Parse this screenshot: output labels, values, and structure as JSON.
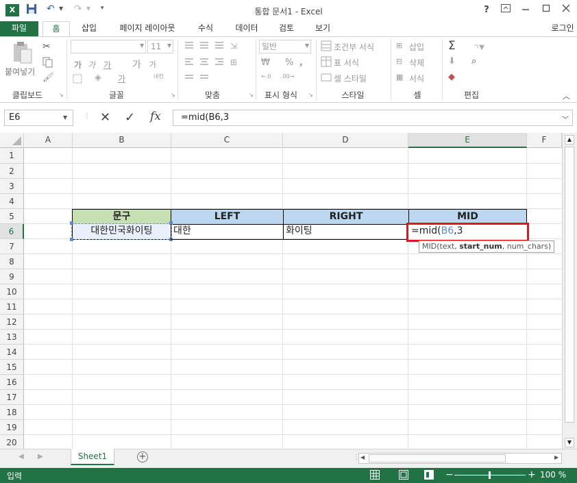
{
  "window": {
    "title": "통합 문서1 - Excel",
    "logo_text": "X",
    "help": "?",
    "user": "로그인"
  },
  "tabs": [
    {
      "label": "파일"
    },
    {
      "label": "홈"
    },
    {
      "label": "삽입"
    },
    {
      "label": "페이지 레이아웃"
    },
    {
      "label": "수식"
    },
    {
      "label": "데이터"
    },
    {
      "label": "검토"
    },
    {
      "label": "보기"
    }
  ],
  "ribbon": {
    "clipboard": {
      "paste_label": "붙여넣기",
      "group_label": "클립보드"
    },
    "font": {
      "size": "11",
      "group_label": "글꼴",
      "bold": "가",
      "italic": "가",
      "underline": "가",
      "grow": "가",
      "shrink": "가",
      "phonetic": "내천"
    },
    "alignment": {
      "group_label": "맞춤"
    },
    "number": {
      "format": "일반",
      "group_label": "표시 형식",
      "percent": "%"
    },
    "styles": {
      "conditional": "조건부 서식",
      "table": "표 서식",
      "cell_styles": "셀 스타일",
      "group_label": "스타일"
    },
    "cells": {
      "insert": "삽입",
      "delete": "삭제",
      "format": "서식",
      "group_label": "셀"
    },
    "editing": {
      "group_label": "편집"
    }
  },
  "formula_bar": {
    "name_box": "E6",
    "cancel": "✕",
    "enter": "✓",
    "fx": "fx",
    "formula": "=mid(B6,3"
  },
  "columns": [
    "A",
    "B",
    "C",
    "D",
    "E",
    "F"
  ],
  "rows": [
    "1",
    "2",
    "3",
    "4",
    "5",
    "6",
    "7",
    "8",
    "9",
    "10",
    "11",
    "12",
    "13",
    "14",
    "15",
    "16",
    "17",
    "18",
    "19",
    "20"
  ],
  "table": {
    "headers": [
      "문구",
      "LEFT",
      "RIGHT",
      "MID"
    ],
    "row6": {
      "b": "대한민국화이팅",
      "c": "대한",
      "d": "화이팅",
      "e_prefix": "=mid(",
      "e_ref": "B6",
      "e_suffix": ",3"
    },
    "header_colors": {
      "b": "#c6e0b4",
      "cde": "#bdd7ee"
    },
    "ref_color": "#5b8bd0"
  },
  "tooltip": {
    "prefix": "MID(text, ",
    "bold": "start_num",
    "suffix": ", num_chars)"
  },
  "sheet": {
    "tab": "Sheet1",
    "add": "+"
  },
  "status": {
    "mode": "입력",
    "zoom": "100 %"
  }
}
